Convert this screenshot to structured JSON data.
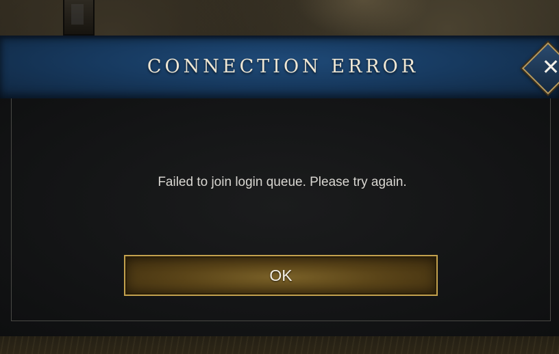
{
  "dialog": {
    "title": "CONNECTION ERROR",
    "close_icon": "close-icon",
    "close_glyph": "✕",
    "message": "Failed to join login queue. Please try again.",
    "ok_label": "OK"
  },
  "colors": {
    "header_blue": "#173a60",
    "button_gold": "#c4a24e",
    "title_text": "#efe7d4"
  }
}
